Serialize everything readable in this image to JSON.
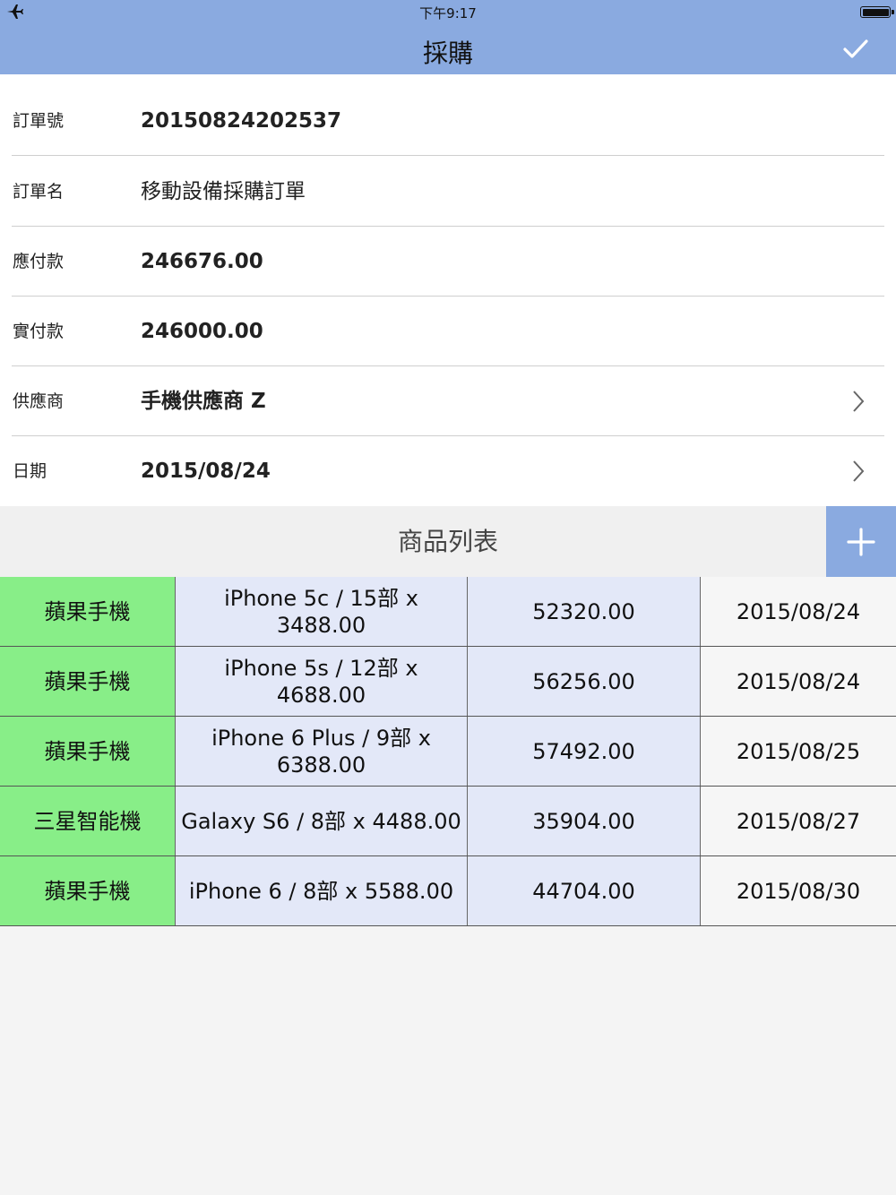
{
  "status_bar": {
    "time": "下午9:17",
    "airplane_icon": "airplane-icon",
    "battery_icon": "battery-icon"
  },
  "nav": {
    "title": "採購",
    "confirm_icon": "checkmark-icon"
  },
  "form": {
    "order_no": {
      "label": "訂單號",
      "value": "20150824202537"
    },
    "order_name": {
      "label": "訂單名",
      "value": "移動設備採購訂單"
    },
    "payable": {
      "label": "應付款",
      "value": "246676.00"
    },
    "paid": {
      "label": "實付款",
      "value": "246000.00"
    },
    "supplier": {
      "label": "供應商",
      "value": "手機供應商 Z"
    },
    "date": {
      "label": "日期",
      "value": "2015/08/24"
    }
  },
  "products": {
    "title": "商品列表",
    "add_icon": "plus-icon",
    "rows": [
      {
        "category": "蘋果手機",
        "detail": "iPhone 5c / 15部 x 3488.00",
        "amount": "52320.00",
        "date": "2015/08/24"
      },
      {
        "category": "蘋果手機",
        "detail": "iPhone 5s / 12部 x 4688.00",
        "amount": "56256.00",
        "date": "2015/08/24"
      },
      {
        "category": "蘋果手機",
        "detail": "iPhone 6 Plus / 9部 x 6388.00",
        "amount": "57492.00",
        "date": "2015/08/25"
      },
      {
        "category": "三星智能機",
        "detail": "Galaxy S6 / 8部 x 4488.00",
        "amount": "35904.00",
        "date": "2015/08/27"
      },
      {
        "category": "蘋果手機",
        "detail": "iPhone 6 / 8部 x 5588.00",
        "amount": "44704.00",
        "date": "2015/08/30"
      }
    ]
  },
  "colors": {
    "header": "#8aaae0",
    "category_cell": "#88ee88",
    "detail_cell": "#e3e8f8"
  }
}
